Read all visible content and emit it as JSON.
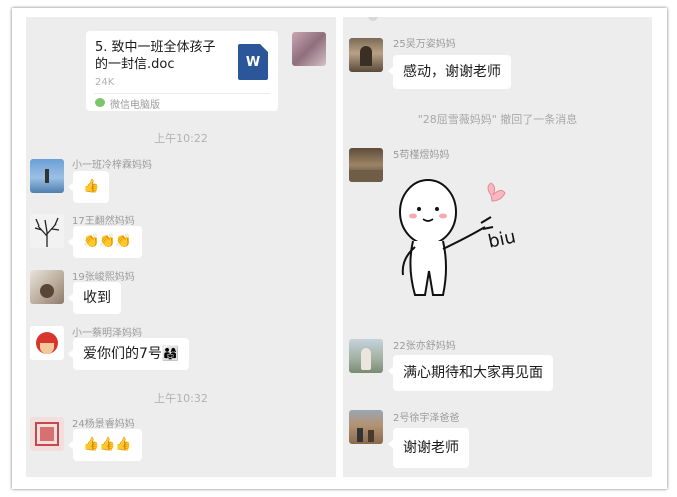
{
  "left": {
    "file_card": {
      "title": "5. 致中一班全体孩子的一封信.doc",
      "title_line1": "5. 致中一班全体孩子",
      "title_line2": "的一封信.doc",
      "size": "24K",
      "icon_letter": "W",
      "source": "微信电脑版"
    },
    "time1": "上午10:22",
    "messages": [
      {
        "name": "小一班冷梓霖妈妈",
        "content": "👍"
      },
      {
        "name": "17王翻然妈妈",
        "content": "👏👏👏"
      },
      {
        "name": "19张峻熙妈妈",
        "content": "收到"
      },
      {
        "name": "小一蔡明泽妈妈",
        "content": "爱你们的7号👨‍👩‍👧"
      }
    ],
    "time2": "上午10:32",
    "last_message": {
      "name": "24杨景睿妈妈",
      "content": "👍👍👍"
    }
  },
  "right": {
    "messages": [
      {
        "name": "25吴万姿妈妈",
        "content": "感动，谢谢老师"
      },
      {
        "name": "5苟槿煜妈妈",
        "sticker_text": "biu"
      },
      {
        "name": "22张亦舒妈妈",
        "content": "满心期待和大家再见面"
      },
      {
        "name": "2号徐宇泽爸爸",
        "content": "谢谢老师"
      }
    ],
    "recall_notice": "\"28屈雪薇妈妈\" 撤回了一条消息"
  }
}
